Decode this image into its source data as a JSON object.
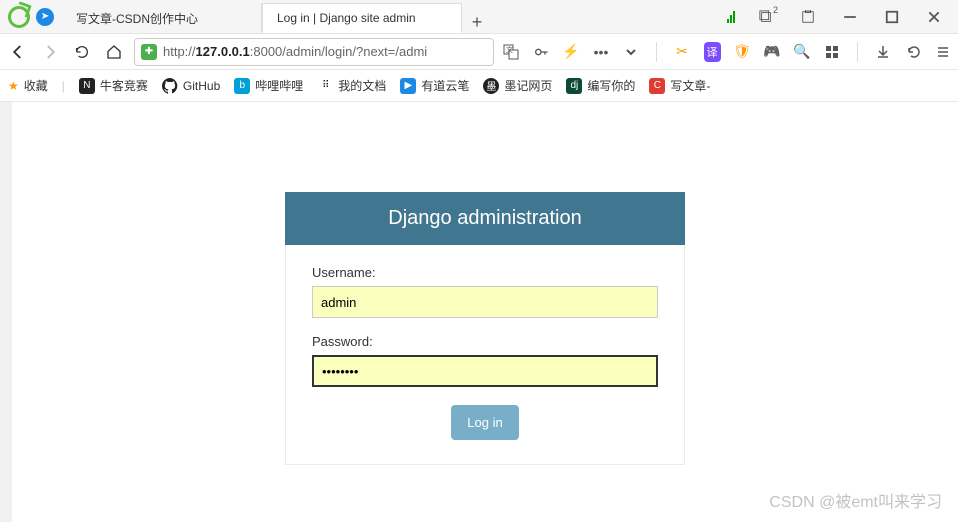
{
  "browser": {
    "tabs": [
      {
        "title": "写文章-CSDN创作中心",
        "active": false
      },
      {
        "title": "Log in | Django site admin",
        "active": true
      }
    ],
    "url": {
      "scheme": "http://",
      "host": "127.0.0.1",
      "port_path": ":8000/admin/login/?next=/admi"
    },
    "badge_count": "2"
  },
  "bookmarks": {
    "fav_label": "收藏",
    "items": [
      {
        "label": "牛客竞赛"
      },
      {
        "label": "GitHub"
      },
      {
        "label": "哔哩哔哩"
      },
      {
        "label": "我的文档"
      },
      {
        "label": "有道云笔"
      },
      {
        "label": "墨记网页"
      },
      {
        "label": "编写你的"
      },
      {
        "label": "写文章-"
      }
    ]
  },
  "login": {
    "header": "Django administration",
    "username_label": "Username:",
    "username_value": "admin",
    "password_label": "Password:",
    "password_value": "••••••••",
    "submit_label": "Log in"
  },
  "watermark": "CSDN @被emt叫来学习"
}
